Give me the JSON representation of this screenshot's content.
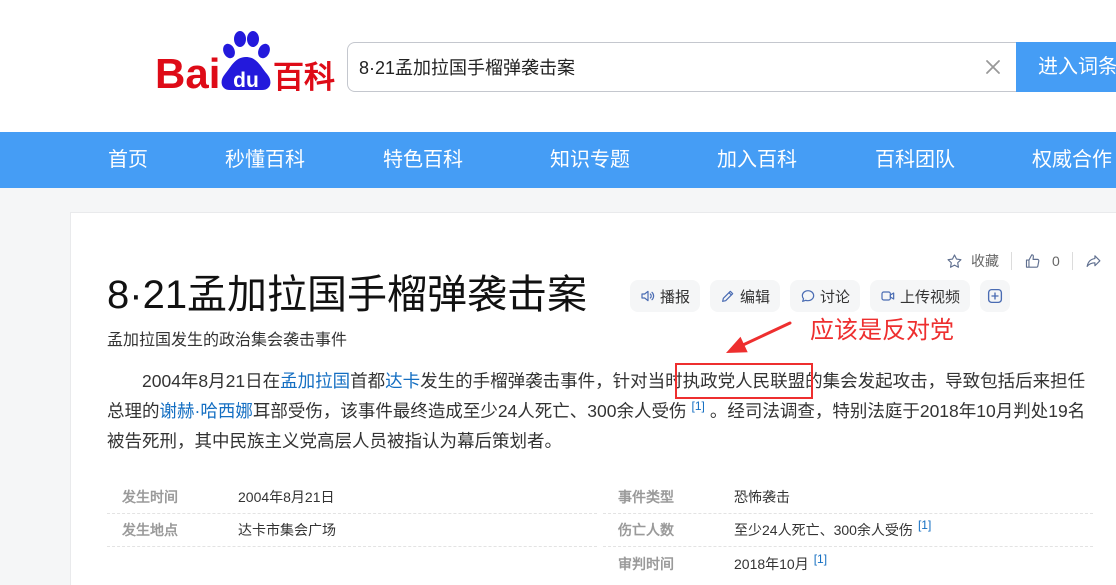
{
  "header": {
    "logo": {
      "text_bai": "Bai",
      "text_du": "du",
      "text_baike": "百科"
    },
    "search": {
      "value": "8·21孟加拉国手榴弹袭击案"
    },
    "search_button": "进入词条"
  },
  "nav": {
    "items": [
      {
        "label": "首页"
      },
      {
        "label": "秒懂百科"
      },
      {
        "label": "特色百科"
      },
      {
        "label": "知识专题"
      },
      {
        "label": "加入百科"
      },
      {
        "label": "百科团队"
      },
      {
        "label": "权威合作"
      }
    ]
  },
  "article": {
    "toolbar": {
      "favorite": "收藏",
      "like_count": "0"
    },
    "title": "8·21孟加拉国手榴弹袭击案",
    "actions": {
      "broadcast": "播报",
      "edit": "编辑",
      "discuss": "讨论",
      "upload_video": "上传视频"
    },
    "subtitle": "孟加拉国发生的政治集会袭击事件",
    "summary": {
      "text_1": "2004年8月21日在",
      "link_1": "孟加拉国",
      "text_2": "首都",
      "link_2": "达卡",
      "text_3": "发生的手榴弹袭击事件，针对当时",
      "highlight": "执政党人民联盟",
      "text_4": "的集会发起攻击，导致包括后来担任",
      "text_5": "总理的",
      "link_3": "谢赫·哈西娜",
      "text_6": "耳部受伤，该事件最终造成至少24人死亡、300余人受伤",
      "ref_1": "[1]",
      "text_7": "。经司法调查，特别法庭于2018年10月判处19名",
      "text_8": "被告死刑，其中民族主义党高层人员被指认为幕后策划者。"
    },
    "basic_info": {
      "rows": [
        {
          "left": {
            "label": "发生时间",
            "value": "2004年8月21日"
          },
          "right": {
            "label": "事件类型",
            "value": "恐怖袭击"
          }
        },
        {
          "left": {
            "label": "发生地点",
            "value": "达卡市集会广场"
          },
          "right": {
            "label": "伤亡人数",
            "value": "至少24人死亡、300余人受伤",
            "ref": "[1]"
          }
        },
        {
          "right": {
            "label": "审判时间",
            "value": "2018年10月",
            "ref": "[1]"
          }
        }
      ]
    }
  },
  "annotation": {
    "note": "应该是反对党"
  },
  "icons": {
    "clear": "close-icon",
    "favorite": "star-icon",
    "like": "thumbs-up-icon",
    "share": "share-icon",
    "broadcast": "speaker-icon",
    "edit": "pencil-icon",
    "discuss": "chat-bubble-icon",
    "upload_video": "video-camera-icon",
    "add": "plus-square-icon",
    "logo": "paw-icon"
  },
  "colors": {
    "brand_red": "#de0b17",
    "brand_blue": "#2319dc",
    "nav_blue": "#459df5",
    "link_blue": "#136ec2",
    "annotation_red": "#ee2f2f",
    "page_bg": "#f5f6f7",
    "action_icon": "#4a6cb3"
  }
}
